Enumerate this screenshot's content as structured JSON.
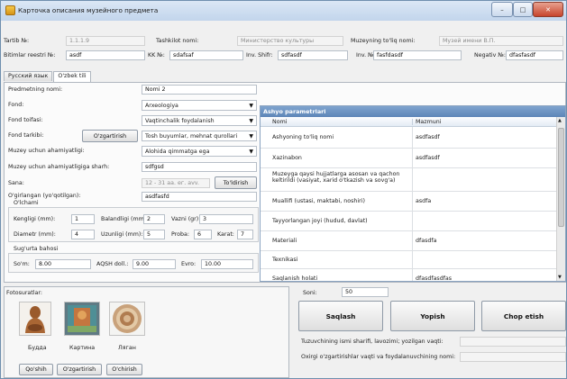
{
  "window": {
    "title": "Карточка описания музейного предмета",
    "minimize_icon": "–",
    "maximize_icon": "□",
    "close_icon": "✕"
  },
  "top": {
    "tartib_label": "Tartib №:",
    "tartib_value": "1.1.1.9",
    "tashkilot_label": "Tashkilot nomi:",
    "tashkilot_value": "Министерство культуры",
    "muzey_label": "Muzeyning to'liq nomi:",
    "muzey_value": "Музей имени В.П.",
    "bitimlar_label": "Bitimlar reestri №:",
    "bitimlar_value": "asdf",
    "kk_label": "KK №:",
    "kk_value": "sdafsaf",
    "inv_shifr_label": "Inv. Shifr:",
    "inv_shifr_value": "sdfasdf",
    "inv_no_label": "Inv. №:",
    "inv_no_value": "fasfdasdf",
    "negativ_label": "Negativ №:",
    "negativ_value": "dfasfasdf"
  },
  "tabs": [
    {
      "label": "Русский язык"
    },
    {
      "label": "O'zbek tili"
    }
  ],
  "form": {
    "predmet_label": "Predmetning nomi:",
    "predmet_value": "Nomi 2",
    "fond_label": "Fond:",
    "fond_value": "Arxeologiya",
    "fond_toifasi_label": "Fond toifasi:",
    "fond_toifasi_value": "Vaqtinchalik foydalanish",
    "fond_tarkibi_label": "Fond tarkibi:",
    "ozgartirish_btn": "O'zgartirish",
    "fond_tarkibi_value": "Tosh buyumlar, mehnat qurollari",
    "ahamiyat_label": "Muzey uchun ahamiyatligi:",
    "ahamiyat_value": "Alohida qimmatga ega",
    "sharh_label": "Muzey uchun ahamiyatligiga sharh:",
    "sharh_value": "sdfgsd",
    "sana_label": "Sana:",
    "sana_placeholder": "12 - 31 аа. ег. avv.",
    "toldirish_btn": "To'ldirish",
    "olingan_label": "O'girlangan (yo'qotilgan):",
    "olingan_label2": "O'lchami",
    "olingan_value": "asdfasfd",
    "kengligi_label": "Kengligi (mm):",
    "kengligi_value": "1",
    "balandligi_label": "Balandligi (mm):",
    "balandligi_value": "2",
    "vazni_label": "Vazni (gr):",
    "vazni_value": "3",
    "diametr_label": "Diametr (mm):",
    "diametr_value": "4",
    "uzunligi_label": "Uzunligi (mm):",
    "uzunligi_value": "5",
    "proba_label": "Proba:",
    "proba_value": "6",
    "karat_label": "Karat:",
    "karat_value": "7",
    "sugurta_label": "Sug'urta bahosi",
    "som_label": "So'm:",
    "som_value": "8.00",
    "aqsh_label": "AQSH doll.:",
    "aqsh_value": "9.00",
    "evro_label": "Evro:",
    "evro_value": "10.00"
  },
  "grid": {
    "title": "Ashyo parametrlari",
    "columns": [
      "Nomi",
      "Mazmuni"
    ],
    "rows": [
      {
        "nomi": "Ashyoning to'liq nomi",
        "mazmuni": "asdfasdf"
      },
      {
        "nomi": "Xazinabon",
        "mazmuni": "asdfasdf"
      },
      {
        "nomi": "Muzeyga qaysi hujjatlarga asosan va qachon keltirildi (vasiyat, xarid o'tkazish va sovg'a)",
        "mazmuni": ""
      },
      {
        "nomi": "Muallifi (ustasi, maktabi, noshiri)",
        "mazmuni": "asdfa"
      },
      {
        "nomi": "Tayyorlangan joyi (hudud, davlat)",
        "mazmuni": ""
      },
      {
        "nomi": "Materiali",
        "mazmuni": "dfasdfa"
      },
      {
        "nomi": "Texnikasi",
        "mazmuni": ""
      },
      {
        "nomi": "Saqlanish holati",
        "mazmuni": "dfasdfasdfas"
      }
    ]
  },
  "photos": {
    "label": "Fotosuratlar:",
    "items": [
      {
        "caption": "Будда",
        "icon": "buddha-statue-photo"
      },
      {
        "caption": "Картина",
        "icon": "painting-photo"
      },
      {
        "caption": "Ляган",
        "icon": "plate-photo"
      }
    ],
    "add_btn": "Qo'shih",
    "edit_btn": "O'zgartirish",
    "delete_btn": "O'chirish"
  },
  "bottom": {
    "soni_label": "Soni:",
    "soni_value": "50",
    "save_btn": "Saqlash",
    "close_btn": "Yopish",
    "print_btn": "Chop etish",
    "tuzuvchi_label": "Tuzuvchining ismi sharifi, lavozimi; yozilgan vaqti:",
    "oxirgi_label": "Oxirgi o'zgartirishlar vaqti va foydalanuvchining nomi:"
  }
}
